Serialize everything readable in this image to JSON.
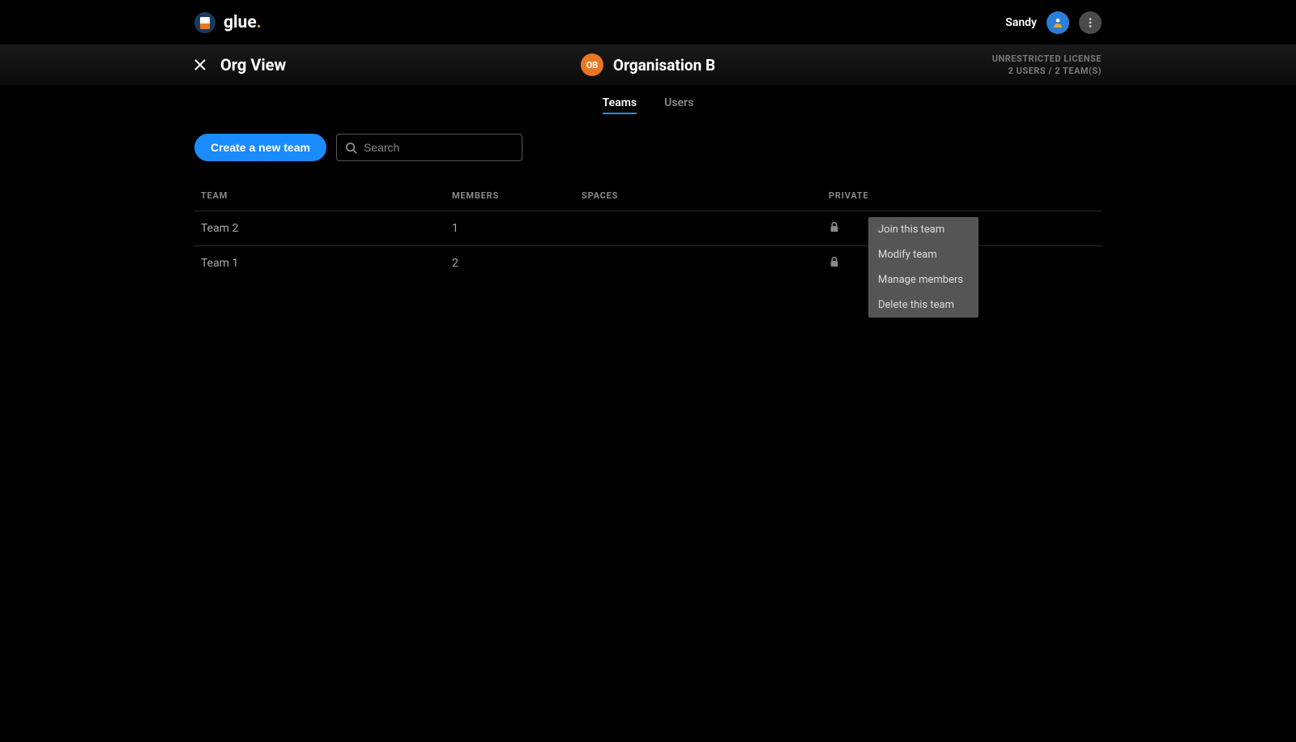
{
  "header": {
    "brand": "glue",
    "username": "Sandy",
    "page_title": "Org View",
    "org_badge": "OB",
    "org_name": "Organisation B",
    "license_line1": "UNRESTRICTED LICENSE",
    "license_line2": "2 USERS / 2 TEAM(S)"
  },
  "tabs": {
    "teams": "Teams",
    "users": "Users"
  },
  "toolbar": {
    "create_label": "Create a new team",
    "search_placeholder": "Search"
  },
  "table": {
    "columns": {
      "team": "TEAM",
      "members": "MEMBERS",
      "spaces": "SPACES",
      "private": "PRIVATE"
    },
    "rows": [
      {
        "team": "Team 2",
        "members": "1",
        "spaces": "",
        "private": true
      },
      {
        "team": "Team 1",
        "members": "2",
        "spaces": "",
        "private": true
      }
    ]
  },
  "context_menu": {
    "join": "Join this team",
    "modify": "Modify team",
    "manage": "Manage members",
    "delete": "Delete this team"
  }
}
